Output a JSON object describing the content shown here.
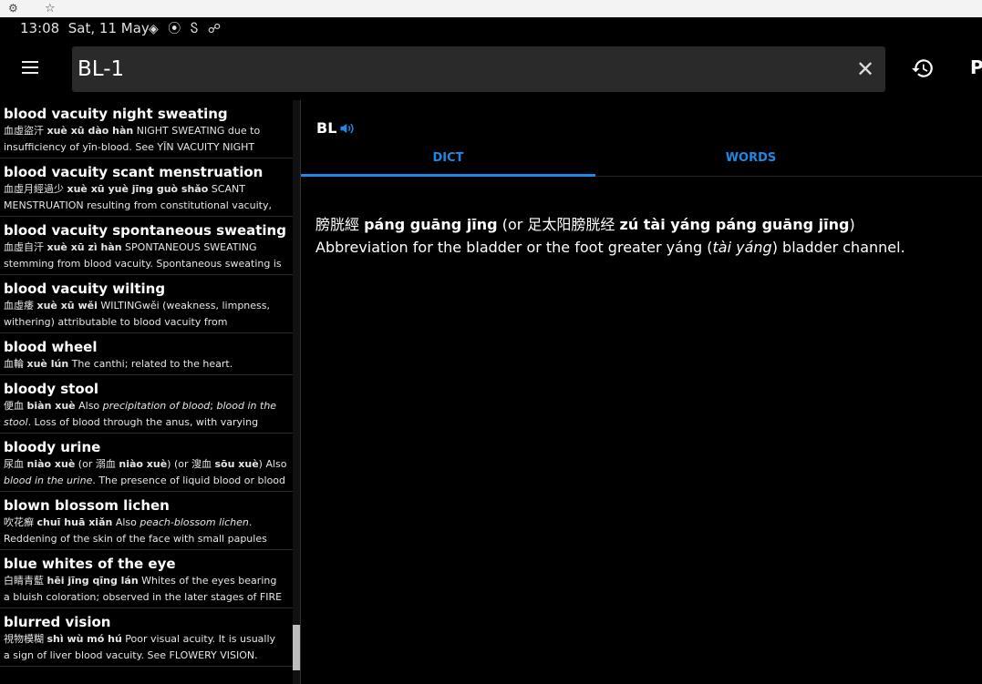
{
  "browser": {
    "gear_icon": "gear-icon",
    "star_icon": "star-icon"
  },
  "status_bar": {
    "time": "13:08",
    "date": "Sat, 11 May",
    "icons": "◈ ⦿ Ⴝ ☍"
  },
  "search": {
    "value": "BL-1"
  },
  "app_bar": {
    "right_letter": "P"
  },
  "list": [
    {
      "title": "blood vacuity night sweating",
      "l1": [
        {
          "t": "血虛盜汗 "
        },
        {
          "t": "xuè xū dào hàn",
          "b": true
        },
        {
          "t": " NIGHT SWEATING due to"
        }
      ],
      "l2": [
        {
          "t": "insufficiency of yīn-blood. See YĪN VACUITY NIGHT"
        }
      ]
    },
    {
      "title": "blood vacuity scant menstruation",
      "l1": [
        {
          "t": "血虛月經過少 "
        },
        {
          "t": "xuè xū yuè jīng guò shǎo",
          "b": true
        },
        {
          "t": " SCANT"
        }
      ],
      "l2": [
        {
          "t": "MENSTRUATION resulting from constitutional vacuity,"
        }
      ]
    },
    {
      "title": "blood vacuity spontaneous sweating",
      "l1": [
        {
          "t": "血虛自汗 "
        },
        {
          "t": "xuè xū zì hàn",
          "b": true
        },
        {
          "t": " SPONTANEOUS SWEATING"
        }
      ],
      "l2": [
        {
          "t": "stemming from blood vacuity. Spontaneous sweating is"
        }
      ]
    },
    {
      "title": "blood vacuity wilting",
      "l1": [
        {
          "t": "血虛痿 "
        },
        {
          "t": "xuè xū wěi",
          "b": true
        },
        {
          "t": " WILTINGwěi (weakness, limpness,"
        }
      ],
      "l2": [
        {
          "t": "withering) attributable to blood vacuity from"
        }
      ]
    },
    {
      "title": "blood wheel",
      "short": true,
      "l1": [
        {
          "t": "血輪 "
        },
        {
          "t": "xuè lún",
          "b": true
        },
        {
          "t": " The canthi; related to the heart."
        }
      ],
      "l2": []
    },
    {
      "title": "bloody stool",
      "l1": [
        {
          "t": "便血 "
        },
        {
          "t": "biàn xuè",
          "b": true
        },
        {
          "t": " Also "
        },
        {
          "t": "precipitation of blood",
          "i": true
        },
        {
          "t": "; "
        },
        {
          "t": "blood in the",
          "i": true
        }
      ],
      "l2": [
        {
          "t": "stool",
          "i": true
        },
        {
          "t": ". Loss of blood through the anus, with varying"
        }
      ]
    },
    {
      "title": "bloody urine",
      "l1": [
        {
          "t": "尿血 "
        },
        {
          "t": "niào xuè",
          "b": true
        },
        {
          "t": " (or 溺血 "
        },
        {
          "t": "niào xuè",
          "b": true
        },
        {
          "t": ") (or 溲血 "
        },
        {
          "t": "sōu xuè",
          "b": true
        },
        {
          "t": ") Also"
        }
      ],
      "l2": [
        {
          "t": "blood in the urine",
          "i": true
        },
        {
          "t": ". The presence of liquid blood or blood"
        }
      ]
    },
    {
      "title": "blown blossom lichen",
      "l1": [
        {
          "t": "吹花癬 "
        },
        {
          "t": "chuī huā xiǎn",
          "b": true
        },
        {
          "t": " Also "
        },
        {
          "t": "peach-blossom lichen",
          "i": true
        },
        {
          "t": "."
        }
      ],
      "l2": [
        {
          "t": "Reddening of the skin of the face with small papules"
        }
      ]
    },
    {
      "title": "blue whites of the eye",
      "l1": [
        {
          "t": "白睛青藍 "
        },
        {
          "t": "hēi jīng qīng lán",
          "b": true
        },
        {
          "t": " Whites of the eyes bearing"
        }
      ],
      "l2": [
        {
          "t": "a bluish coloration; observed in the later stages of FIRE"
        }
      ]
    },
    {
      "title": "blurred vision",
      "l1": [
        {
          "t": "視物模糊 "
        },
        {
          "t": "shì wù mó hú",
          "b": true
        },
        {
          "t": " Poor visual acuity. It is usually"
        }
      ],
      "l2": [
        {
          "t": "a sign of liver blood vacuity. See FLOWERY VISION."
        }
      ]
    }
  ],
  "detail": {
    "head_word": "BL",
    "tabs": [
      {
        "label": "DICT"
      },
      {
        "label": "WORDS"
      }
    ],
    "line1": [
      {
        "t": "膀胱經 "
      },
      {
        "t": "páng guāng jīng",
        "b": true
      },
      {
        "t": " (or 足太阳膀胱经 "
      },
      {
        "t": "zú tài yáng páng guāng jīng",
        "b": true
      },
      {
        "t": ")"
      }
    ],
    "line2": [
      {
        "t": "Abbreviation for the bladder or the foot greater yáng ("
      },
      {
        "t": "tài yáng",
        "i": true
      },
      {
        "t": ") bladder channel."
      }
    ]
  }
}
